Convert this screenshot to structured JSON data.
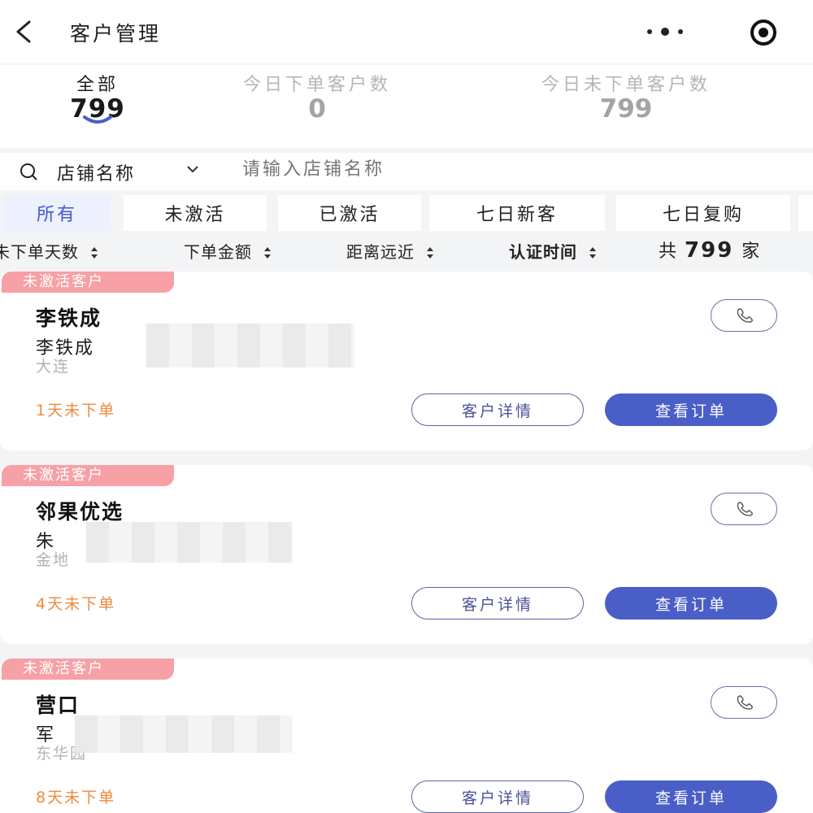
{
  "header": {
    "title": "客户管理"
  },
  "stats": [
    {
      "label": "全部",
      "value": "799"
    },
    {
      "label": "今日下单客户数",
      "value": "0"
    },
    {
      "label": "今日未下单客户数",
      "value": "799"
    }
  ],
  "search": {
    "field": "店铺名称",
    "placeholder": "请输入店铺名称"
  },
  "tabs": [
    "所有",
    "未激活",
    "已激活",
    "七日新客",
    "七日复购"
  ],
  "sort": [
    "未下单天数",
    "下单金额",
    "距离远近",
    "认证时间"
  ],
  "total": {
    "prefix": "共",
    "count": "799",
    "suffix": "家"
  },
  "customers": [
    {
      "tag": "未激活客户",
      "name": "李铁成",
      "person": "李铁成",
      "address": "大连",
      "days": "1天未下单",
      "detail_label": "客户详情",
      "order_label": "查看订单"
    },
    {
      "tag": "未激活客户",
      "name": "邻果优选",
      "person": "朱",
      "address": "金地",
      "days": "4天未下单",
      "detail_label": "客户详情",
      "order_label": "查看订单"
    },
    {
      "tag": "未激活客户",
      "name": "营口",
      "person": "军",
      "address": "东华园",
      "days": "8天未下单",
      "detail_label": "客户详情",
      "order_label": "查看订单"
    }
  ],
  "colors": {
    "accent": "#4a5ec8",
    "tag": "#f7a0a6",
    "warning": "#ee8a3e"
  }
}
